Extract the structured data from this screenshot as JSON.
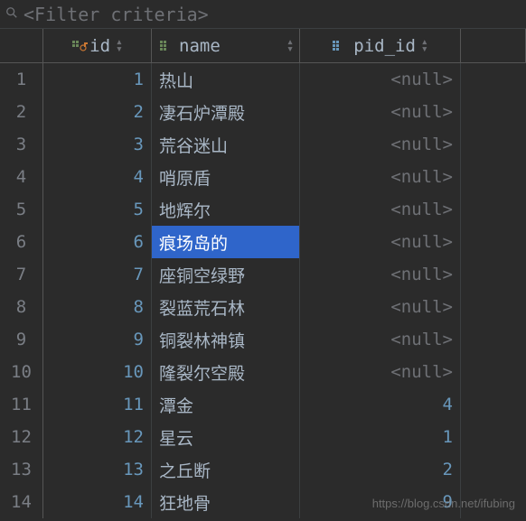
{
  "filter": {
    "placeholder": "<Filter criteria>"
  },
  "columns": {
    "id": "id",
    "name": "name",
    "pid": "pid_id"
  },
  "rows": [
    {
      "num": "1",
      "id": "1",
      "name": "热山",
      "pid": "<null>",
      "pid_null": true
    },
    {
      "num": "2",
      "id": "2",
      "name": "凄石炉潭殿",
      "pid": "<null>",
      "pid_null": true
    },
    {
      "num": "3",
      "id": "3",
      "name": "荒谷迷山",
      "pid": "<null>",
      "pid_null": true
    },
    {
      "num": "4",
      "id": "4",
      "name": "哨原盾",
      "pid": "<null>",
      "pid_null": true
    },
    {
      "num": "5",
      "id": "5",
      "name": "地辉尔",
      "pid": "<null>",
      "pid_null": true
    },
    {
      "num": "6",
      "id": "6",
      "name": "痕场岛的",
      "pid": "<null>",
      "pid_null": true,
      "selected": true
    },
    {
      "num": "7",
      "id": "7",
      "name": "座铜空绿野",
      "pid": "<null>",
      "pid_null": true
    },
    {
      "num": "8",
      "id": "8",
      "name": "裂蓝荒石林",
      "pid": "<null>",
      "pid_null": true
    },
    {
      "num": "9",
      "id": "9",
      "name": "铜裂林神镇",
      "pid": "<null>",
      "pid_null": true
    },
    {
      "num": "10",
      "id": "10",
      "name": "隆裂尔空殿",
      "pid": "<null>",
      "pid_null": true
    },
    {
      "num": "11",
      "id": "11",
      "name": "潭金",
      "pid": "4",
      "pid_null": false
    },
    {
      "num": "12",
      "id": "12",
      "name": "星云",
      "pid": "1",
      "pid_null": false
    },
    {
      "num": "13",
      "id": "13",
      "name": "之丘断",
      "pid": "2",
      "pid_null": false
    },
    {
      "num": "14",
      "id": "14",
      "name": "狂地骨",
      "pid": "9",
      "pid_null": false
    }
  ],
  "watermark": "https://blog.csdn.net/ifubing"
}
